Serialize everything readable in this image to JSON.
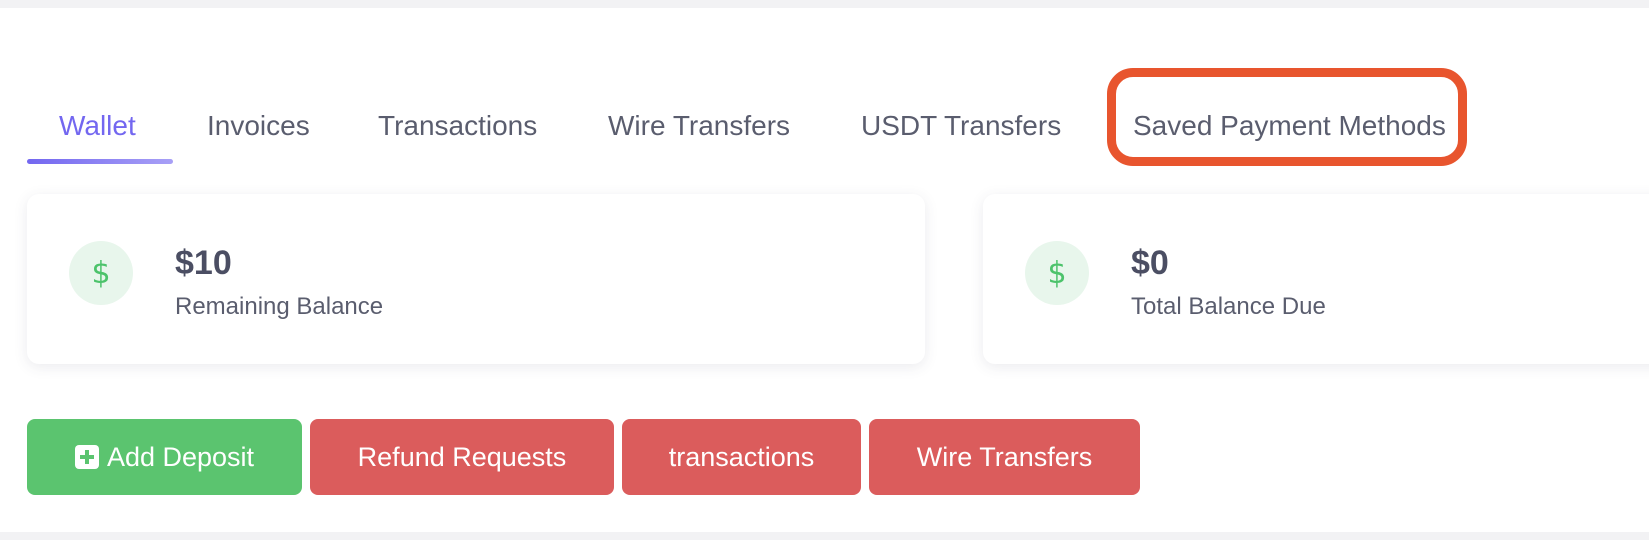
{
  "tabs": [
    {
      "label": "Wallet",
      "active": true
    },
    {
      "label": "Invoices",
      "active": false
    },
    {
      "label": "Transactions",
      "active": false
    },
    {
      "label": "Wire Transfers",
      "active": false
    },
    {
      "label": "USDT Transfers",
      "active": false
    },
    {
      "label": "Saved Payment Methods",
      "active": false,
      "highlighted": true
    }
  ],
  "cards": [
    {
      "icon": "dollar-icon",
      "amount": "$10",
      "label": "Remaining Balance"
    },
    {
      "icon": "dollar-icon",
      "amount": "$0",
      "label": "Total Balance Due"
    }
  ],
  "buttons": {
    "add_deposit": {
      "label": "Add Deposit",
      "icon": "plus-square-icon"
    },
    "refund_requests": {
      "label": "Refund Requests"
    },
    "transactions": {
      "label": "transactions"
    },
    "wire_transfers": {
      "label": "Wire Transfers"
    }
  },
  "icons": {
    "dollar_glyph": "$"
  },
  "colors": {
    "accent": "#7367f0",
    "highlight": "#e8552e",
    "success": "#5bc46f",
    "danger": "#db5c5c",
    "icon_bg": "#e8f6ec",
    "icon_fg": "#4cc36b"
  }
}
